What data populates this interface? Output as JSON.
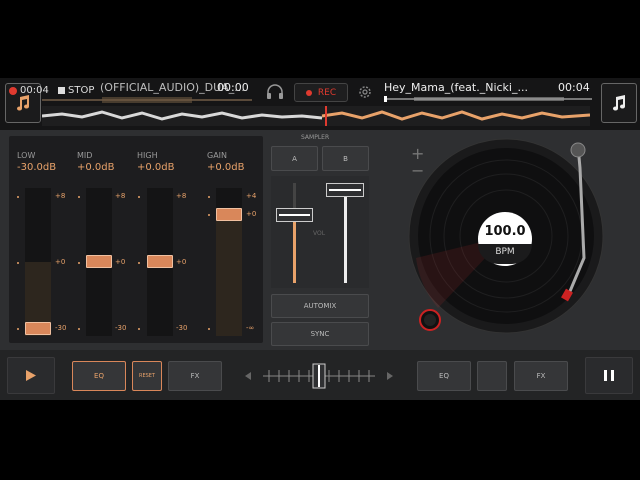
{
  "deckA": {
    "time": "00:04",
    "stop_label": "STOP",
    "title": "(OFFICIAL_AUDIO)_DUA_...",
    "remaining": "00:00"
  },
  "deckB": {
    "title": "Hey_Mama_(feat._Nicki_...",
    "time": "00:04"
  },
  "rec_label": "REC",
  "eq": {
    "low_label": "LOW",
    "low_value": "-30.0dB",
    "mid_label": "MID",
    "mid_value": "+0.0dB",
    "high_label": "HIGH",
    "high_value": "+0.0dB",
    "gain_label": "GAIN",
    "gain_value": "+0.0dB",
    "tick_plus8": "+8",
    "tick_zero": "+0",
    "tick_minus30": "-30",
    "gain_tick_plus4": "+4",
    "gain_tick_zero": "+0",
    "gain_tick_minus_inf": "-∞"
  },
  "sampler": {
    "label": "SAMPLER",
    "a": "A",
    "b": "B"
  },
  "vol_label": "VOL",
  "automix_label": "AUTOMIX",
  "sync_label": "SYNC",
  "bpm": {
    "value": "100.0",
    "unit": "BPM"
  },
  "bottom": {
    "eq_a": "EQ",
    "reset": "RESET",
    "fx_a": "FX",
    "eq_b": "EQ",
    "fx_b": "FX"
  },
  "colors": {
    "accent": "#e8a26a",
    "rec": "#e03a2f",
    "panel": "#2e2f31"
  }
}
